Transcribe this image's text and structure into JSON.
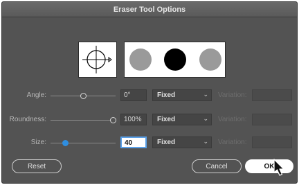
{
  "dialog": {
    "title": "Eraser Tool Options"
  },
  "preview": {
    "dots": [
      {
        "name": "preview-dot-min",
        "color": "#9a9a9a"
      },
      {
        "name": "preview-dot-current",
        "color": "#000000"
      },
      {
        "name": "preview-dot-max",
        "color": "#9a9a9a"
      }
    ]
  },
  "rows": {
    "angle": {
      "label": "Angle:",
      "value": "0°",
      "method": "Fixed",
      "variation_label": "Variation:"
    },
    "roundness": {
      "label": "Roundness:",
      "value": "100%",
      "method": "Fixed",
      "variation_label": "Variation:"
    },
    "size": {
      "label": "Size:",
      "value": "40",
      "method": "Fixed",
      "variation_label": "Variation:"
    }
  },
  "buttons": {
    "reset": "Reset",
    "cancel": "Cancel",
    "ok": "OK"
  },
  "colors": {
    "accent": "#2f8ee0",
    "panel": "#535353"
  },
  "icons": {
    "dropdown": "chevron-down-icon",
    "cursor": "pointer-cursor-icon",
    "angle_preview": "crosshair-circle-icon"
  }
}
